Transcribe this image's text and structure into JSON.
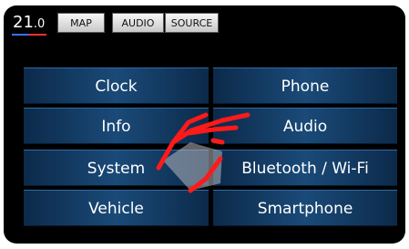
{
  "status": {
    "temp_main": "21",
    "temp_decimal": ".0"
  },
  "topbar": {
    "map_label": "MAP",
    "audio_label": "AUDIO",
    "source_label": "SOURCE"
  },
  "menu": {
    "clock": "Clock",
    "phone": "Phone",
    "info": "Info",
    "audio": "Audio",
    "system": "System",
    "bluetooth_wifi": "Bluetooth / Wi-Fi",
    "vehicle": "Vehicle",
    "smartphone": "Smartphone"
  },
  "colors": {
    "button_blue": "#1a4a78",
    "gesture_red": "#ff1a1a"
  },
  "icons": {
    "gesture": "swipe-gesture-icon"
  }
}
